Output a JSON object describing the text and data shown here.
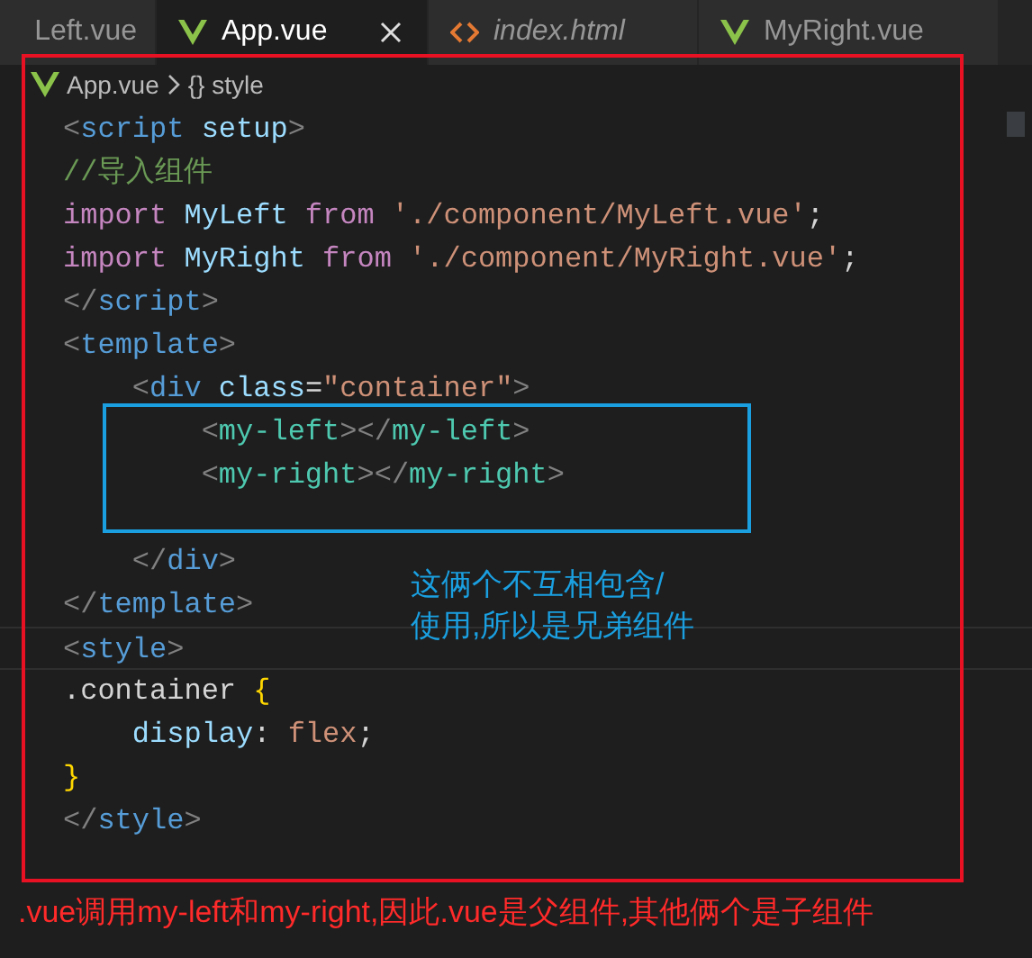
{
  "tabs": [
    {
      "label": "Left.vue",
      "kind": "vue",
      "selected": false,
      "italic": false
    },
    {
      "label": "App.vue",
      "kind": "vue",
      "selected": true,
      "italic": false
    },
    {
      "label": "index.html",
      "kind": "html",
      "selected": false,
      "italic": true
    },
    {
      "label": "MyRight.vue",
      "kind": "vue",
      "selected": false,
      "italic": false
    }
  ],
  "breadcrumb": [
    "App.vue",
    "{} style"
  ],
  "code": [
    {
      "kind": "code",
      "tokens": [
        {
          "text": "<",
          "kind": "punct"
        },
        {
          "text": "script",
          "kind": "tag"
        },
        {
          "text": " setup",
          "kind": "attr"
        },
        {
          "text": ">",
          "kind": "punct"
        }
      ]
    },
    {
      "kind": "code",
      "tokens": [
        {
          "text": "//导入组件",
          "kind": "comment"
        }
      ]
    },
    {
      "kind": "code",
      "tokens": [
        {
          "text": "import",
          "kind": "keyword"
        },
        {
          "text": " MyLeft ",
          "kind": "var"
        },
        {
          "text": "from",
          "kind": "keyword"
        },
        {
          "text": " './component/MyLeft.vue'",
          "kind": "string"
        },
        {
          "text": ";",
          "kind": "plain"
        }
      ]
    },
    {
      "kind": "code",
      "tokens": [
        {
          "text": "import",
          "kind": "keyword"
        },
        {
          "text": " MyRight ",
          "kind": "var"
        },
        {
          "text": "from",
          "kind": "keyword"
        },
        {
          "text": " './component/MyRight.vue'",
          "kind": "string"
        },
        {
          "text": ";",
          "kind": "plain"
        }
      ]
    },
    {
      "kind": "code",
      "tokens": [
        {
          "text": "</",
          "kind": "punct"
        },
        {
          "text": "script",
          "kind": "tag"
        },
        {
          "text": ">",
          "kind": "punct"
        }
      ]
    },
    {
      "kind": "code",
      "tokens": [
        {
          "text": "<",
          "kind": "punct"
        },
        {
          "text": "template",
          "kind": "tag"
        },
        {
          "text": ">",
          "kind": "punct"
        }
      ]
    },
    {
      "kind": "code",
      "tokens": [
        {
          "text": "    <",
          "kind": "punct"
        },
        {
          "text": "div",
          "kind": "tag"
        },
        {
          "text": " class",
          "kind": "attr"
        },
        {
          "text": "=",
          "kind": "plain"
        },
        {
          "text": "\"container\"",
          "kind": "string"
        },
        {
          "text": ">",
          "kind": "punct"
        }
      ]
    },
    {
      "kind": "code",
      "tokens": [
        {
          "text": "        <",
          "kind": "punct"
        },
        {
          "text": "my-left",
          "kind": "component"
        },
        {
          "text": "></",
          "kind": "punct"
        },
        {
          "text": "my-left",
          "kind": "component"
        },
        {
          "text": ">",
          "kind": "punct"
        }
      ]
    },
    {
      "kind": "code",
      "tokens": [
        {
          "text": "        <",
          "kind": "punct"
        },
        {
          "text": "my-right",
          "kind": "component"
        },
        {
          "text": "></",
          "kind": "punct"
        },
        {
          "text": "my-right",
          "kind": "component"
        },
        {
          "text": ">",
          "kind": "punct"
        }
      ]
    },
    {
      "kind": "blank"
    },
    {
      "kind": "code",
      "tokens": [
        {
          "text": "    </",
          "kind": "punct"
        },
        {
          "text": "div",
          "kind": "tag"
        },
        {
          "text": ">",
          "kind": "punct"
        }
      ]
    },
    {
      "kind": "code",
      "tokens": [
        {
          "text": "</",
          "kind": "punct"
        },
        {
          "text": "template",
          "kind": "tag"
        },
        {
          "text": ">",
          "kind": "punct"
        }
      ]
    },
    {
      "kind": "code",
      "current": true,
      "tokens": [
        {
          "text": "<",
          "kind": "punct"
        },
        {
          "text": "style",
          "kind": "tag"
        },
        {
          "text": ">",
          "kind": "punct"
        }
      ]
    },
    {
      "kind": "code",
      "tokens": [
        {
          "text": ".container ",
          "kind": "plain"
        },
        {
          "text": "{",
          "kind": "brace"
        }
      ]
    },
    {
      "kind": "code",
      "tokens": [
        {
          "text": "    display",
          "kind": "attr"
        },
        {
          "text": ": ",
          "kind": "plain"
        },
        {
          "text": "flex",
          "kind": "string"
        },
        {
          "text": ";",
          "kind": "plain"
        }
      ]
    },
    {
      "kind": "code",
      "tokens": [
        {
          "text": "}",
          "kind": "brace"
        }
      ]
    },
    {
      "kind": "code",
      "tokens": [
        {
          "text": "</",
          "kind": "punct"
        },
        {
          "text": "style",
          "kind": "tag"
        },
        {
          "text": ">",
          "kind": "punct"
        }
      ]
    }
  ],
  "annotations": {
    "note": [
      "这俩个不互相包含/",
      "使用,所以是兄弟组件"
    ],
    "caption": ".vue调用my-left和my-right,因此.vue是父组件,其他俩个是子组件"
  }
}
